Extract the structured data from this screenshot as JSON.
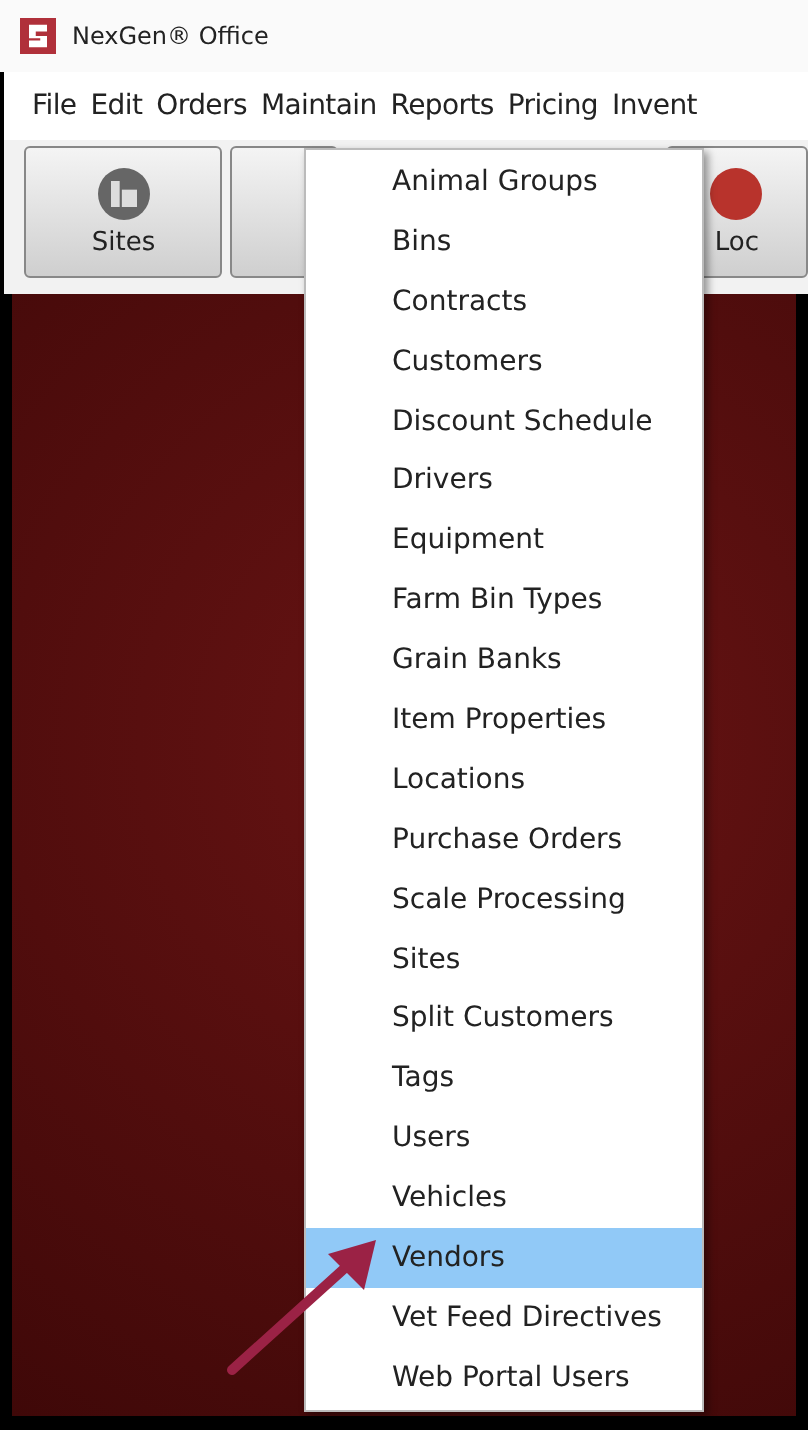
{
  "window": {
    "title": "NexGen® Office"
  },
  "menu_bar": [
    {
      "label": "File"
    },
    {
      "label": "Edit"
    },
    {
      "label": "Orders"
    },
    {
      "label": "Maintain"
    },
    {
      "label": "Reports"
    },
    {
      "label": "Pricing"
    },
    {
      "label": "Invent"
    }
  ],
  "toolbar": [
    {
      "label": "Sites",
      "kind": "sites"
    },
    {
      "kind": "blank"
    },
    {
      "label": "Loc",
      "kind": "loc"
    }
  ],
  "dropdown": [
    {
      "label": "Animal Groups",
      "selected": false
    },
    {
      "label": "Bins",
      "selected": false
    },
    {
      "label": "Contracts",
      "selected": false
    },
    {
      "label": "Customers",
      "selected": false
    },
    {
      "label": "Discount Schedule",
      "selected": false
    },
    {
      "label": "Drivers",
      "selected": false
    },
    {
      "label": "Equipment",
      "selected": false
    },
    {
      "label": "Farm Bin Types",
      "selected": false
    },
    {
      "label": "Grain Banks",
      "selected": false
    },
    {
      "label": "Item Properties",
      "selected": false
    },
    {
      "label": "Locations",
      "selected": false
    },
    {
      "label": "Purchase Orders",
      "selected": false
    },
    {
      "label": "Scale Processing",
      "selected": false
    },
    {
      "label": "Sites",
      "selected": false
    },
    {
      "label": "Split Customers",
      "selected": false
    },
    {
      "label": "Tags",
      "selected": false
    },
    {
      "label": "Users",
      "selected": false
    },
    {
      "label": "Vehicles",
      "selected": false
    },
    {
      "label": "Vendors",
      "selected": true
    },
    {
      "label": "Vet Feed Directives",
      "selected": false
    },
    {
      "label": "Web Portal Users",
      "selected": false
    }
  ]
}
